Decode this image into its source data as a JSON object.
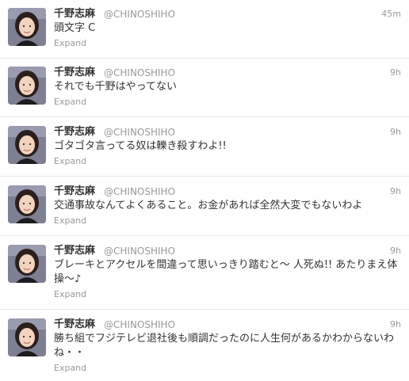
{
  "tweets": [
    {
      "author_name": "千野志麻",
      "screen_name": "@CHINOSHIHO",
      "timestamp": "45m",
      "text": "頭文字 C",
      "expand_label": "Expand"
    },
    {
      "author_name": "千野志麻",
      "screen_name": "@CHINOSHIHO",
      "timestamp": "9h",
      "text": "それでも千野はやってない",
      "expand_label": "Expand"
    },
    {
      "author_name": "千野志麻",
      "screen_name": "@CHINOSHIHO",
      "timestamp": "9h",
      "text": "ゴタゴタ言ってる奴は轢き殺すわよ!!",
      "expand_label": "Expand"
    },
    {
      "author_name": "千野志麻",
      "screen_name": "@CHINOSHIHO",
      "timestamp": "9h",
      "text": "交通事故なんてよくあること。お金があれば全然大変でもないわよ",
      "expand_label": "Expand"
    },
    {
      "author_name": "千野志麻",
      "screen_name": "@CHINOSHIHO",
      "timestamp": "9h",
      "text": "ブレーキとアクセルを間違って思いっきり踏むと〜 人死ぬ!! あたりまえ体操〜♪",
      "expand_label": "Expand"
    },
    {
      "author_name": "千野志麻",
      "screen_name": "@CHINOSHIHO",
      "timestamp": "9h",
      "text": "勝ち組でフジテレビ退社後も順調だったのに人生何があるかわからないわね・・",
      "expand_label": "Expand"
    }
  ],
  "colors": {
    "name": "#333333",
    "meta": "#999999",
    "divider": "#e8e8e8",
    "avatar_bg": "#7e7f93"
  }
}
